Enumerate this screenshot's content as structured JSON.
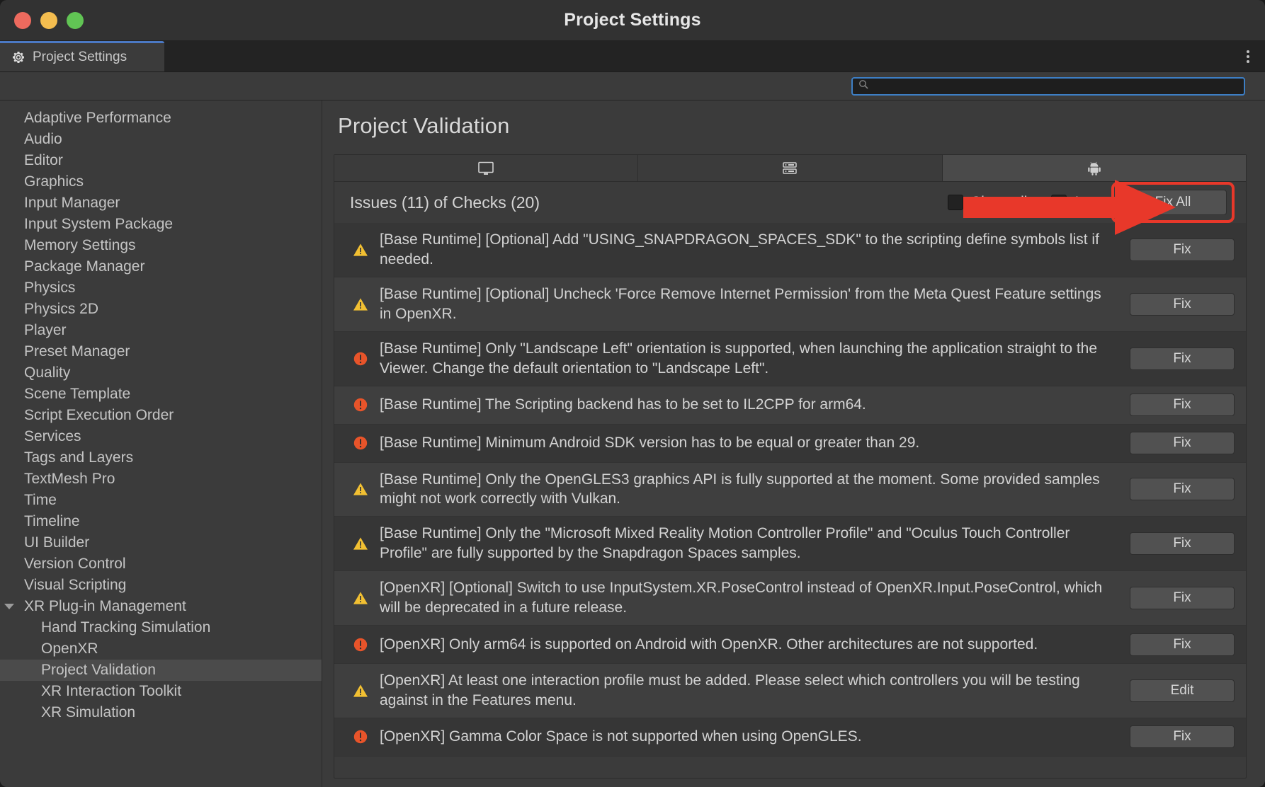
{
  "window": {
    "title": "Project Settings",
    "traffic_lights": [
      "close-red",
      "minimize-yellow",
      "zoom-green"
    ]
  },
  "editor_tab": {
    "label": "Project Settings",
    "icon": "gear-icon",
    "menu_icon": "kebab-menu-icon"
  },
  "search": {
    "value": "",
    "placeholder": "",
    "icon": "search-icon"
  },
  "sidebar": {
    "items": [
      {
        "label": "Adaptive Performance",
        "level": 0,
        "selected": false
      },
      {
        "label": "Audio",
        "level": 0,
        "selected": false
      },
      {
        "label": "Editor",
        "level": 0,
        "selected": false
      },
      {
        "label": "Graphics",
        "level": 0,
        "selected": false
      },
      {
        "label": "Input Manager",
        "level": 0,
        "selected": false
      },
      {
        "label": "Input System Package",
        "level": 0,
        "selected": false
      },
      {
        "label": "Memory Settings",
        "level": 0,
        "selected": false
      },
      {
        "label": "Package Manager",
        "level": 0,
        "selected": false
      },
      {
        "label": "Physics",
        "level": 0,
        "selected": false
      },
      {
        "label": "Physics 2D",
        "level": 0,
        "selected": false
      },
      {
        "label": "Player",
        "level": 0,
        "selected": false
      },
      {
        "label": "Preset Manager",
        "level": 0,
        "selected": false
      },
      {
        "label": "Quality",
        "level": 0,
        "selected": false
      },
      {
        "label": "Scene Template",
        "level": 0,
        "selected": false
      },
      {
        "label": "Script Execution Order",
        "level": 0,
        "selected": false
      },
      {
        "label": "Services",
        "level": 0,
        "selected": false
      },
      {
        "label": "Tags and Layers",
        "level": 0,
        "selected": false
      },
      {
        "label": "TextMesh Pro",
        "level": 0,
        "selected": false
      },
      {
        "label": "Time",
        "level": 0,
        "selected": false
      },
      {
        "label": "Timeline",
        "level": 0,
        "selected": false
      },
      {
        "label": "UI Builder",
        "level": 0,
        "selected": false
      },
      {
        "label": "Version Control",
        "level": 0,
        "selected": false
      },
      {
        "label": "Visual Scripting",
        "level": 0,
        "selected": false
      },
      {
        "label": "XR Plug-in Management",
        "level": 0,
        "selected": false,
        "expanded": true
      },
      {
        "label": "Hand Tracking Simulation",
        "level": 1,
        "selected": false
      },
      {
        "label": "OpenXR",
        "level": 1,
        "selected": false
      },
      {
        "label": "Project Validation",
        "level": 1,
        "selected": true
      },
      {
        "label": "XR Interaction Toolkit",
        "level": 1,
        "selected": false
      },
      {
        "label": "XR Simulation",
        "level": 1,
        "selected": false
      }
    ]
  },
  "main": {
    "title": "Project Validation",
    "platform_tabs": [
      {
        "icon": "desktop-monitor-icon",
        "active": false
      },
      {
        "icon": "server-rack-icon",
        "active": false
      },
      {
        "icon": "android-robot-icon",
        "active": true
      }
    ],
    "issues_header": {
      "count_text": "Issues (11) of Checks (20)",
      "show_all_label": "Show all",
      "ignore_label": "Ig",
      "fix_all_label": "Fix All",
      "highlight_color": "#e8382a"
    },
    "issues": [
      {
        "severity": "warning",
        "text": "[Base Runtime] [Optional] Add \"USING_SNAPDRAGON_SPACES_SDK\" to the scripting define symbols list if needed.",
        "action": "Fix"
      },
      {
        "severity": "warning",
        "text": "[Base Runtime] [Optional] Uncheck 'Force Remove Internet Permission' from the Meta Quest Feature settings in OpenXR.",
        "action": "Fix"
      },
      {
        "severity": "error",
        "text": "[Base Runtime] Only \"Landscape Left\" orientation is supported, when launching the application straight to the Viewer. Change the default orientation to \"Landscape Left\".",
        "action": "Fix"
      },
      {
        "severity": "error",
        "text": "[Base Runtime] The Scripting backend has to be set to IL2CPP for arm64.",
        "action": "Fix"
      },
      {
        "severity": "error",
        "text": "[Base Runtime] Minimum Android SDK version has to be equal or greater than 29.",
        "action": "Fix"
      },
      {
        "severity": "warning",
        "text": "[Base Runtime] Only the OpenGLES3 graphics API is fully supported at the moment. Some provided samples might not work correctly with Vulkan.",
        "action": "Fix"
      },
      {
        "severity": "warning",
        "text": "[Base Runtime] Only the \"Microsoft Mixed Reality Motion Controller Profile\" and \"Oculus Touch Controller Profile\" are fully supported by the Snapdragon Spaces samples.",
        "action": "Fix"
      },
      {
        "severity": "warning",
        "text": "[OpenXR] [Optional] Switch to use InputSystem.XR.PoseControl instead of OpenXR.Input.PoseControl, which will be deprecated in a future release.",
        "action": "Fix"
      },
      {
        "severity": "error",
        "text": "[OpenXR] Only arm64 is supported on Android with OpenXR.  Other architectures are not supported.",
        "action": "Fix"
      },
      {
        "severity": "warning",
        "text": "[OpenXR] At least one interaction profile must be added.  Please select which controllers you will be testing against in the Features menu.",
        "action": "Edit"
      },
      {
        "severity": "error",
        "text": "[OpenXR] Gamma Color Space is not supported when using OpenGLES.",
        "action": "Fix"
      }
    ]
  },
  "colors": {
    "warning": "#f2c032",
    "error": "#e8542a",
    "accent_blue": "#3d7ec4",
    "annotation_red": "#e8382a",
    "panel_bg": "#3b3b3b",
    "row_alt": "#3f3f3f"
  }
}
